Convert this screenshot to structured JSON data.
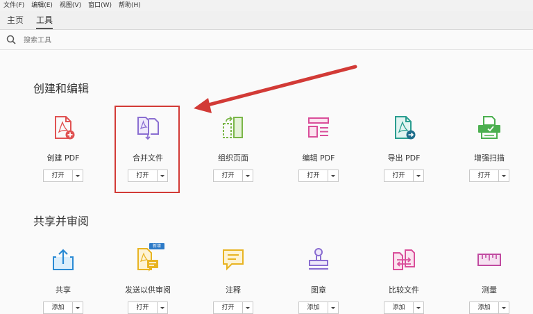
{
  "menubar": [
    "文件(F)",
    "编辑(E)",
    "视图(V)",
    "窗口(W)",
    "帮助(H)"
  ],
  "tabs": [
    {
      "label": "主页",
      "active": false
    },
    {
      "label": "工具",
      "active": true
    }
  ],
  "search": {
    "placeholder": "搜索工具"
  },
  "sections": [
    {
      "title": "创建和编辑",
      "tools": [
        {
          "label": "创建 PDF",
          "button": "打开",
          "icon": "create-pdf-icon",
          "color": "#e05252"
        },
        {
          "label": "合并文件",
          "button": "打开",
          "icon": "combine-files-icon",
          "color": "#8a6ed1",
          "highlighted": true
        },
        {
          "label": "组织页面",
          "button": "打开",
          "icon": "organize-pages-icon",
          "color": "#7ab648"
        },
        {
          "label": "编辑 PDF",
          "button": "打开",
          "icon": "edit-pdf-icon",
          "color": "#d94e9a"
        },
        {
          "label": "导出 PDF",
          "button": "打开",
          "icon": "export-pdf-icon",
          "color": "#2a9d8f"
        },
        {
          "label": "增强扫描",
          "button": "打开",
          "icon": "enhance-scan-icon",
          "color": "#4caf50"
        }
      ]
    },
    {
      "title": "共享并审阅",
      "tools": [
        {
          "label": "共享",
          "button": "添加",
          "icon": "share-icon",
          "color": "#2a8ad4"
        },
        {
          "label": "发送以供审阅",
          "button": "打开",
          "icon": "send-for-review-icon",
          "color": "#e8b422",
          "badge": "新增"
        },
        {
          "label": "注释",
          "button": "打开",
          "icon": "comment-icon",
          "color": "#e8b422"
        },
        {
          "label": "图章",
          "button": "添加",
          "icon": "stamp-icon",
          "color": "#8a6ed1"
        },
        {
          "label": "比较文件",
          "button": "添加",
          "icon": "compare-files-icon",
          "color": "#d94e9a"
        },
        {
          "label": "测量",
          "button": "添加",
          "icon": "measure-icon",
          "color": "#c04aa0"
        }
      ]
    }
  ]
}
